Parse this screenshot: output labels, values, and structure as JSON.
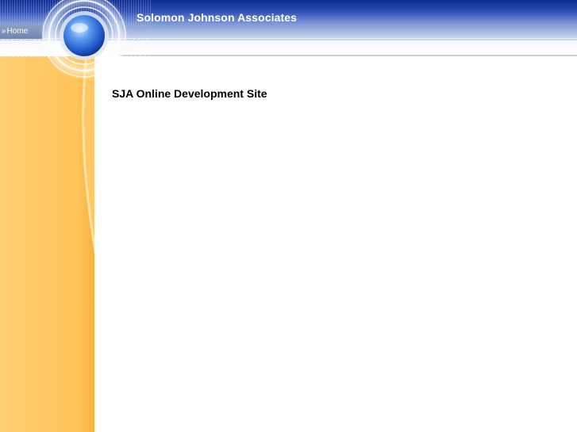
{
  "header": {
    "site_title": "Solomon Johnson Associates"
  },
  "nav": {
    "home_label": "Home",
    "home_icon": "double-chevron-right-icon"
  },
  "main": {
    "heading": "SJA Online Development Site"
  },
  "colors": {
    "header_blue": "#0f2d8f",
    "accent_orange": "#ffc866",
    "globe_blue": "#2b6fd8"
  }
}
